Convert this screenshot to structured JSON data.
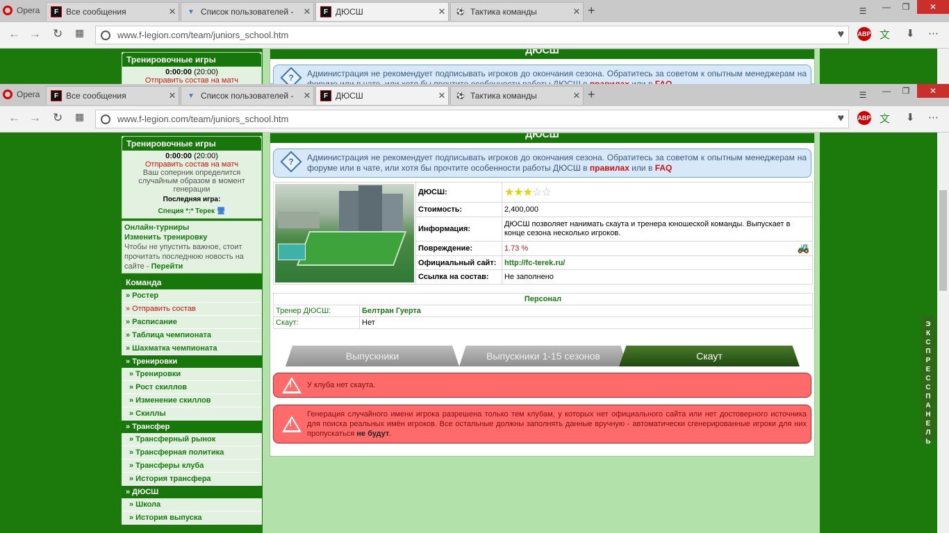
{
  "browser": {
    "app_label": "Opera",
    "tabs": [
      {
        "label": "Все сообщения"
      },
      {
        "label": "Список пользователей -"
      },
      {
        "label": "ДЮСШ"
      },
      {
        "label": "Тактика команды"
      }
    ],
    "url": "www.f-legion.com/team/juniors_school.htm",
    "abp_label": "ABP"
  },
  "sidebar": {
    "training_games": {
      "title": "Тренировочные игры",
      "time": "0:00:00",
      "time_paren": "(20:00)",
      "send_lineup": "Отправить состав на матч",
      "opponent_note": "Ваш соперник определится случайным образом в момент генерации",
      "last_game_label": "Последняя игра:",
      "last_game": "Специя *:* Терек"
    },
    "online_box": {
      "tournaments": "Онлайн-турниры",
      "change_training": "Изменить тренировку",
      "note": "Чтобы не упустить важное, стоит прочитать последнюю новость на сайте -",
      "go": "Перейти"
    },
    "team_title": "Команда",
    "menu": [
      {
        "label": "» Ростер",
        "kind": "item"
      },
      {
        "label": "» Отправить состав",
        "kind": "red"
      },
      {
        "label": "» Расписание",
        "kind": "item"
      },
      {
        "label": "» Таблица чемпионата",
        "kind": "item"
      },
      {
        "label": "» Шахматка чемпионата",
        "kind": "item"
      },
      {
        "label": "» Тренировки",
        "kind": "head"
      },
      {
        "label": "» Тренировки",
        "kind": "sub"
      },
      {
        "label": "» Рост скиллов",
        "kind": "sub"
      },
      {
        "label": "» Изменение скиллов",
        "kind": "sub"
      },
      {
        "label": "» Скиллы",
        "kind": "sub"
      },
      {
        "label": "» Трансфер",
        "kind": "head"
      },
      {
        "label": "» Трансферный рынок",
        "kind": "sub"
      },
      {
        "label": "» Трансферная политика",
        "kind": "sub"
      },
      {
        "label": "» Трансферы клуба",
        "kind": "sub"
      },
      {
        "label": "» История трансфера",
        "kind": "sub"
      },
      {
        "label": "» ДЮСШ",
        "kind": "head"
      },
      {
        "label": "» Школа",
        "kind": "sub"
      },
      {
        "label": "» История выпуска",
        "kind": "sub"
      }
    ]
  },
  "main": {
    "title": "ДЮСШ",
    "notice": {
      "text": "Администрация не рекомендует подписывать игроков до окончания сезона. Обратитесь за советом к опытным менеджерам на форуме или в чате, или хотя бы прочтите особенности работы ДЮСШ в",
      "rules": "правилах",
      "or_in": "или в",
      "faq": "FAQ"
    },
    "info": {
      "school_label": "ДЮСШ:",
      "stars_filled": "★★★",
      "stars_empty": "☆☆",
      "cost_label": "Стоимость:",
      "cost": "2,400,000",
      "info_label": "Информация:",
      "info": "ДЮСШ позволяет нанимать скаута и тренера юношеской команды. Выпускает в конце сезона несколько игроков.",
      "damage_label": "Повреждение:",
      "damage": "1.73 %",
      "site_label": "Официальный сайт:",
      "site": "http://fc-terek.ru/",
      "roster_label": "Ссылка на состав:",
      "roster": "Не заполнено"
    },
    "staff": {
      "title": "Персонал",
      "coach_label": "Тренер ДЮСШ:",
      "coach": "Белтран Гуерта",
      "scout_label": "Скаут:",
      "scout": "Нет"
    },
    "tabs": [
      "Выпускники",
      "Выпускники 1-15 сезонов",
      "Скаут"
    ],
    "alert1": "У клуба нет скаута.",
    "alert2": "Генерация случайного имени игрока разрешена только тем клубам, у которых нет официального сайта или нет достоверного источника для поиска реальных имён игроков. Все остальные должны заполнять данные вручную - автоматически сгенерированные игроки для них пропускаться",
    "alert2_bold": "не будут",
    "alert2_end": "."
  },
  "express_panel": "ЭКСПРЕСС ПАНЕЛЬ"
}
